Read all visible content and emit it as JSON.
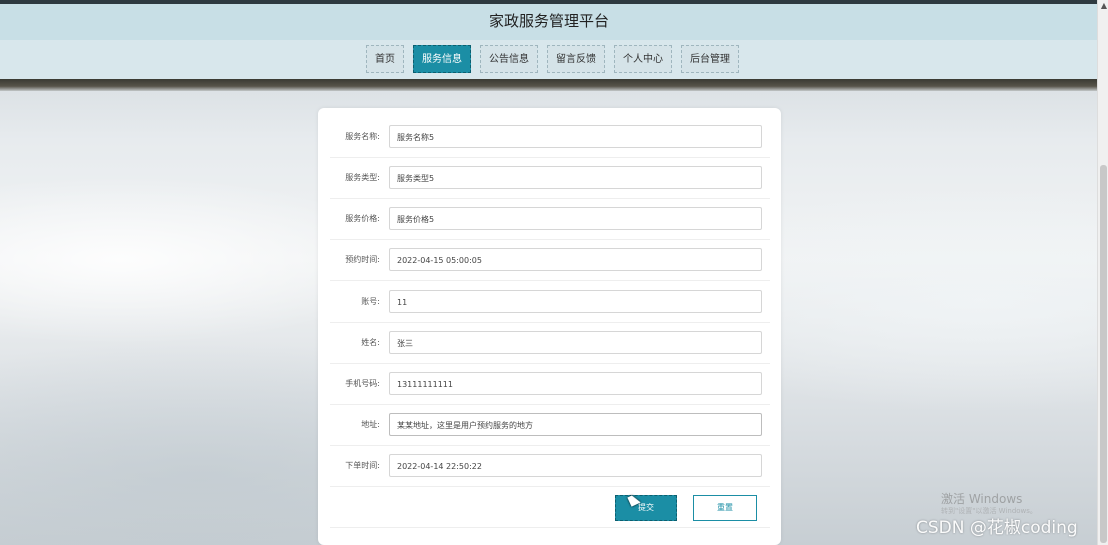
{
  "header": {
    "title": "家政服务管理平台"
  },
  "nav": {
    "items": [
      "首页",
      "服务信息",
      "公告信息",
      "留言反馈",
      "个人中心",
      "后台管理"
    ],
    "active": "服务信息"
  },
  "form": {
    "fields": [
      {
        "label": "服务名称:",
        "value": "服务名称5"
      },
      {
        "label": "服务类型:",
        "value": "服务类型5"
      },
      {
        "label": "服务价格:",
        "value": "服务价格5"
      },
      {
        "label": "预约时间:",
        "value": "2022-04-15 05:00:05"
      },
      {
        "label": "账号:",
        "value": "11"
      },
      {
        "label": "姓名:",
        "value": "张三"
      },
      {
        "label": "手机号码:",
        "value": "13111111111"
      },
      {
        "label": "地址:",
        "value": "某某地址，这里是用户预约服务的地方"
      },
      {
        "label": "下单时间:",
        "value": "2022-04-14 22:50:22"
      }
    ],
    "submit_label": "提交",
    "reset_label": "重置"
  },
  "watermarks": {
    "windows_title": "激活 Windows",
    "windows_sub": "转到\"设置\"以激活 Windows。",
    "csdn": "CSDN @花椒coding"
  },
  "colors": {
    "accent": "#1b8ea5",
    "header_bg": "#c8dfe6"
  }
}
